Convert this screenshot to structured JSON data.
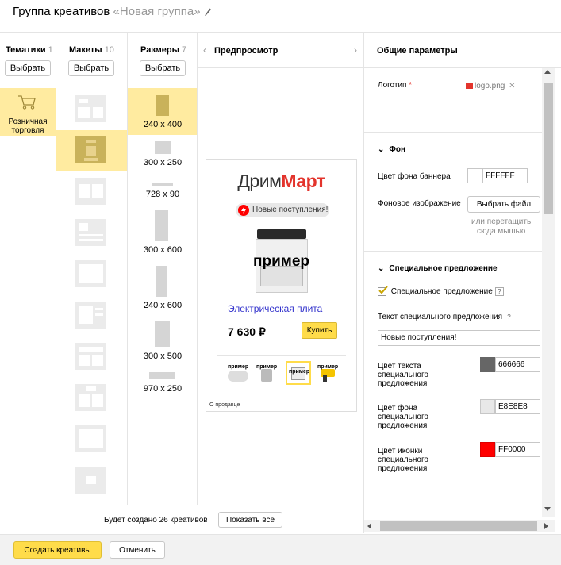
{
  "header": {
    "title": "Группа креативов",
    "group_name": "«Новая группа»"
  },
  "columns": {
    "themes": {
      "label": "Тематики",
      "count": "1",
      "choose": "Выбрать"
    },
    "layouts": {
      "label": "Макеты",
      "count": "10",
      "choose": "Выбрать"
    },
    "sizes": {
      "label": "Размеры",
      "count": "7",
      "choose": "Выбрать"
    }
  },
  "theme_item": {
    "label_line1": "Розничная",
    "label_line2": "торговля",
    "icon": "shopping-cart-icon"
  },
  "sizes": [
    "240 x 400",
    "300 x 250",
    "728 x 90",
    "300 x 600",
    "240 x 600",
    "300 x 500",
    "970 x 250"
  ],
  "preview": {
    "title": "Предпросмотр",
    "brand_dark": "Дрим",
    "brand_red": "Март",
    "badge": "Новые поступления!",
    "watermark": "пример",
    "product_name": "Электрическая плита",
    "price": "7 630 ₽",
    "buy": "Купить",
    "footer": "О продавце"
  },
  "footer_bar": {
    "text": "Будет создано 26 креативов",
    "show_all": "Показать все"
  },
  "actions": {
    "create": "Создать креативы",
    "cancel": "Отменить"
  },
  "params": {
    "title": "Общие параметры",
    "logo_label": "Логотип",
    "logo_required": "*",
    "logo_file": "logo.png",
    "bg_section": "Фон",
    "bg_color_label": "Цвет фона баннера",
    "bg_color_value": "FFFFFF",
    "bg_image_label": "Фоновое изображение",
    "choose_file": "Выбрать файл",
    "drag_hint_1": "или перетащить",
    "drag_hint_2": "сюда мышью",
    "special_section": "Специальное предложение",
    "special_checkbox": "Специальное предложение",
    "special_text_label": "Текст специального предложения",
    "special_text_value": "Новые поступления!",
    "text_color_label": [
      "Цвет текста",
      "специального",
      "предложения"
    ],
    "text_color_value": "666666",
    "bg_fill_label": [
      "Цвет фона",
      "специального",
      "предложения"
    ],
    "bg_fill_value": "E8E8E8",
    "icon_color_label": [
      "Цвет иконки",
      "специального",
      "предложения"
    ],
    "icon_color_value": "FF0000"
  },
  "colors": {
    "accent_yellow": "#ffdc4a",
    "selected_bg": "#ffeba0",
    "brand_red": "#e3342c",
    "link_blue": "#3333cc"
  }
}
